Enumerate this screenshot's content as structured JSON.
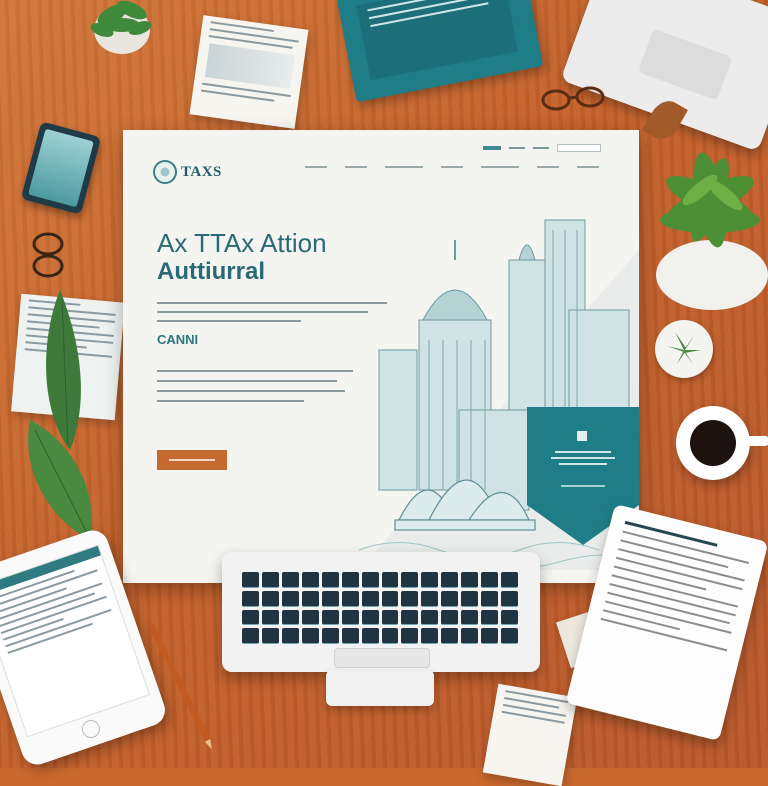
{
  "website": {
    "logo_text": "TAXS",
    "headline_line1": "Ax TTAx Attion",
    "headline_line2": "Auttiurral",
    "cta_label": "CANNI"
  },
  "colors": {
    "desk": "#c8692e",
    "brand_teal": "#1f7d88",
    "cta_orange": "#c56a32",
    "text_teal": "#2a6a74"
  },
  "icons": {
    "logo": "seal-icon",
    "badge": "qr-code-icon"
  }
}
